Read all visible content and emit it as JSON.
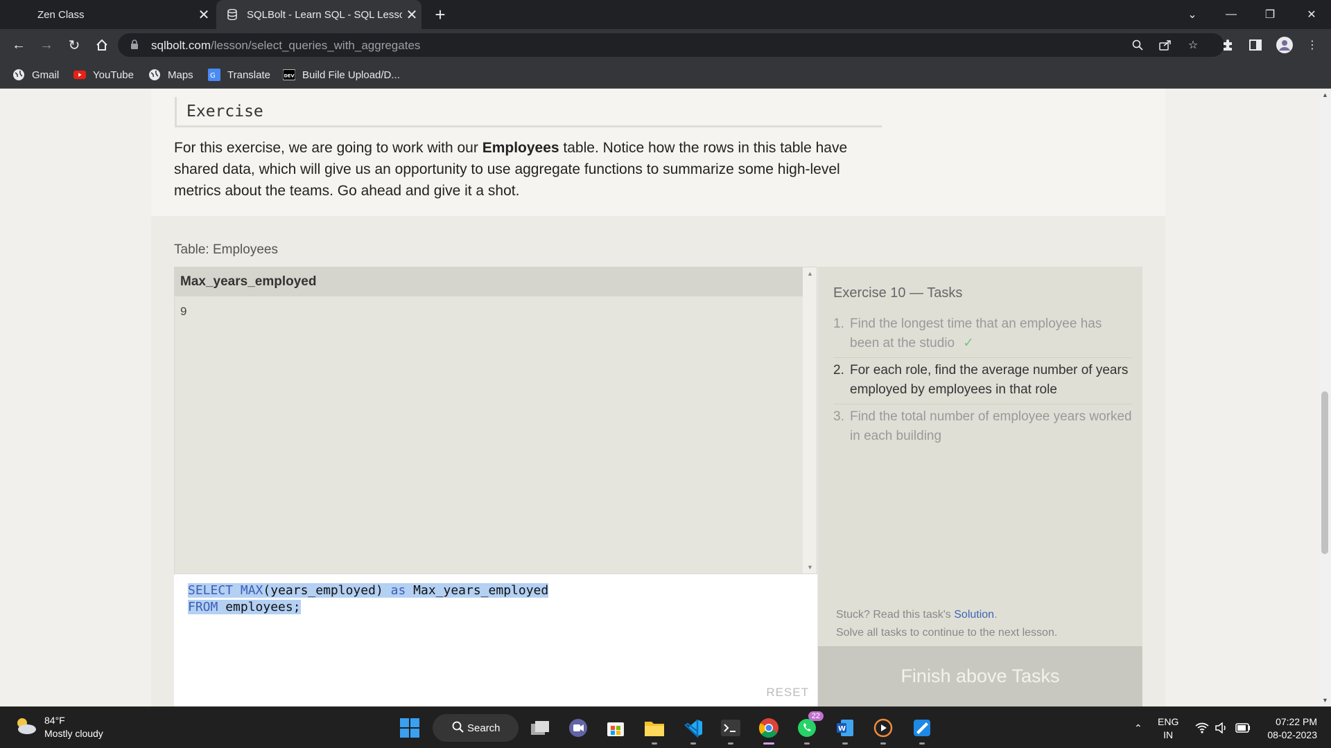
{
  "browser": {
    "tabs": [
      {
        "title": "Zen Class"
      },
      {
        "title": "SQLBolt - Learn SQL - SQL Lesson"
      }
    ],
    "url_host": "sqlbolt.com",
    "url_path": "/lesson/select_queries_with_aggregates",
    "bookmarks": [
      {
        "label": "Gmail",
        "icon": "globe-icon"
      },
      {
        "label": "YouTube",
        "icon": "youtube-icon"
      },
      {
        "label": "Maps",
        "icon": "globe-icon"
      },
      {
        "label": "Translate",
        "icon": "translate-icon"
      },
      {
        "label": "Build File Upload/D...",
        "icon": "dev-icon"
      }
    ]
  },
  "page": {
    "section_title": "Exercise",
    "intro_before": "For this exercise, we are going to work with our ",
    "intro_bold": "Employees",
    "intro_after": " table. Notice how the rows in this table have shared data, which will give us an opportunity to use aggregate functions to summarize some high-level metrics about the teams. Go ahead and give it a shot.",
    "table_label": "Table: Employees",
    "results": {
      "columns": [
        "Max_years_employed"
      ],
      "rows": [
        [
          "9"
        ]
      ]
    },
    "editor": {
      "line1": {
        "kw1": "SELECT",
        "kw2": "MAX",
        "t1": "(years_employed) ",
        "kw3": "as",
        "t2": " Max_years_employed"
      },
      "line2": {
        "kw1": "FROM",
        "t1": " employees;"
      },
      "reset_label": "RESET"
    },
    "tasks_panel": {
      "title": "Exercise 10 — Tasks",
      "tasks": [
        {
          "num": "1.",
          "text": "Find the longest time that an employee has been at the studio",
          "done": true,
          "check": "✓"
        },
        {
          "num": "2.",
          "text": "For each role, find the average number of years employed by employees in that role",
          "done": false
        },
        {
          "num": "3.",
          "text": "Find the total number of employee years worked in each building",
          "done": false
        }
      ],
      "stuck_prefix": "Stuck? Read this task's ",
      "stuck_link": "Solution",
      "stuck_suffix": ".",
      "continue_note": "Solve all tasks to continue to the next lesson.",
      "finish_label": "Finish above Tasks"
    }
  },
  "taskbar": {
    "weather_temp": "84°F",
    "weather_desc": "Mostly cloudy",
    "search_label": "Search",
    "whatsapp_badge": "22",
    "lang_top": "ENG",
    "lang_bottom": "IN",
    "time": "07:22 PM",
    "date": "08-02-2023"
  },
  "colors": {
    "accent_link": "#3c64b4",
    "keyword": "#3c5fb5",
    "selection": "#b4d0f3"
  }
}
